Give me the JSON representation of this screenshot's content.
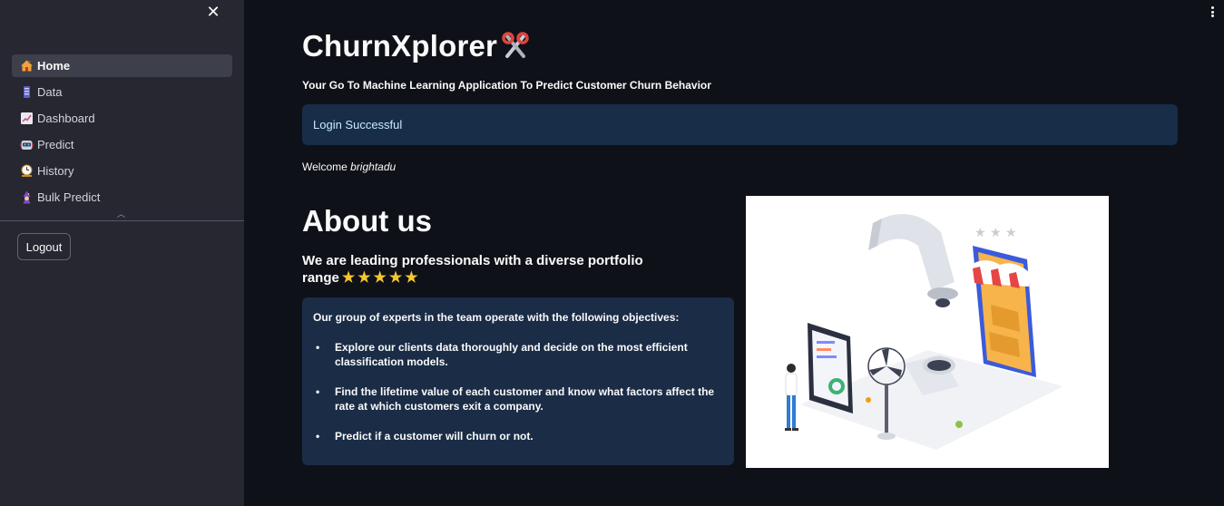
{
  "sidebar": {
    "close_icon": "close-icon",
    "items": [
      {
        "label": "Home",
        "icon": "house-icon",
        "active": true
      },
      {
        "label": "Data",
        "icon": "database-icon",
        "active": false
      },
      {
        "label": "Dashboard",
        "icon": "chart-icon",
        "active": false
      },
      {
        "label": "Predict",
        "icon": "robot-icon",
        "active": false
      },
      {
        "label": "History",
        "icon": "clock-icon",
        "active": false
      },
      {
        "label": "Bulk Predict",
        "icon": "mage-icon",
        "active": false
      }
    ],
    "logout_label": "Logout"
  },
  "main": {
    "title": "ChurnXplorer",
    "title_icon": "scissors-icon",
    "subtitle": "Your Go To Machine Learning Application To Predict Customer Churn Behavior",
    "alert": "Login Successful",
    "welcome_prefix": "Welcome",
    "username": "brightadu",
    "about_heading": "About us",
    "lead": "We are leading professionals with a diverse portfolio range",
    "star_rating": 5,
    "objectives_intro": "Our group of experts in the team operate with the following objectives:",
    "objectives": [
      "Explore our clients data thoroughly and decide on the most efficient classification models.",
      "Find the lifetime value of each customer and know what factors affect the rate at which customers exit a company.",
      "Predict if a customer will churn or not."
    ],
    "illustration": "isometric-online-shop-illustration"
  },
  "colors": {
    "sidebar_bg": "#262730",
    "main_bg": "#0e1117",
    "alert_bg": "#172d48",
    "alert_text": "#c7ebff",
    "card_bg": "#1a2c46",
    "star": "#f7c531"
  }
}
